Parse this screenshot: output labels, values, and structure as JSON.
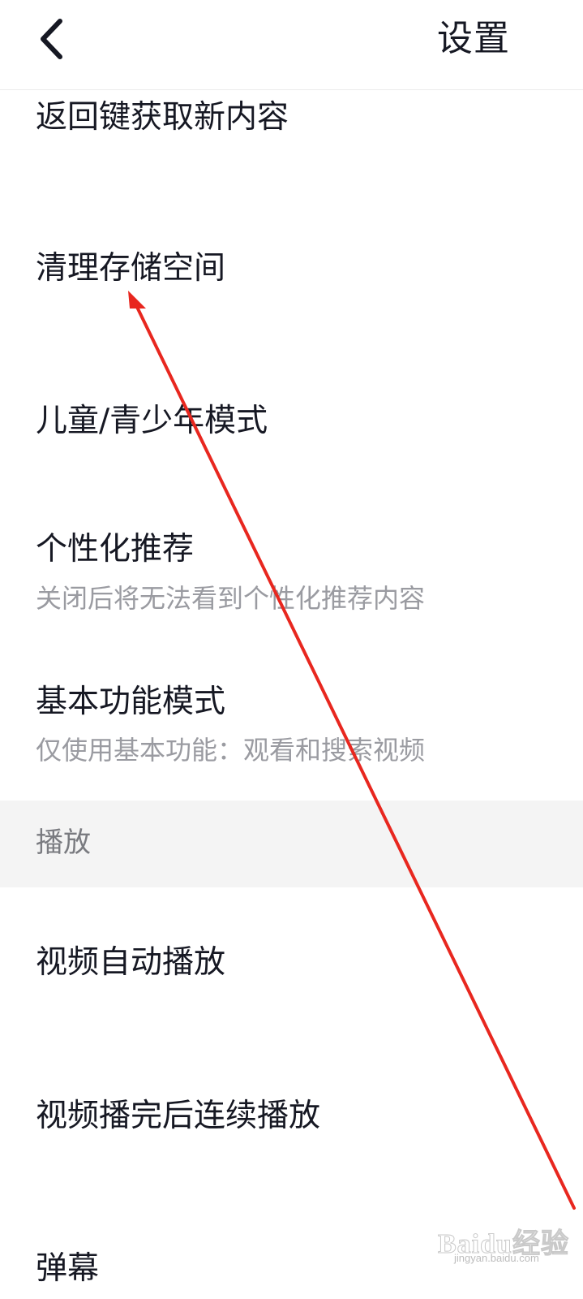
{
  "header": {
    "title": "设置",
    "back_icon": "chevron-left-icon"
  },
  "items": [
    {
      "label": "返回键获取新内容"
    },
    {
      "label": "清理存储空间"
    },
    {
      "label": "儿童/青少年模式"
    },
    {
      "label": "个性化推荐",
      "sub": "关闭后将无法看到个性化推荐内容"
    },
    {
      "label": "基本功能模式",
      "sub": "仅使用基本功能：观看和搜索视频"
    }
  ],
  "section": {
    "label": "播放"
  },
  "play_items": [
    {
      "label": "视频自动播放"
    },
    {
      "label": "视频播完后连续播放"
    },
    {
      "label": "弹幕"
    }
  ],
  "annotation": {
    "arrow_color": "#e8271f"
  },
  "watermark": {
    "text": "Baidu经验",
    "url": "jingyan.baidu.com"
  }
}
